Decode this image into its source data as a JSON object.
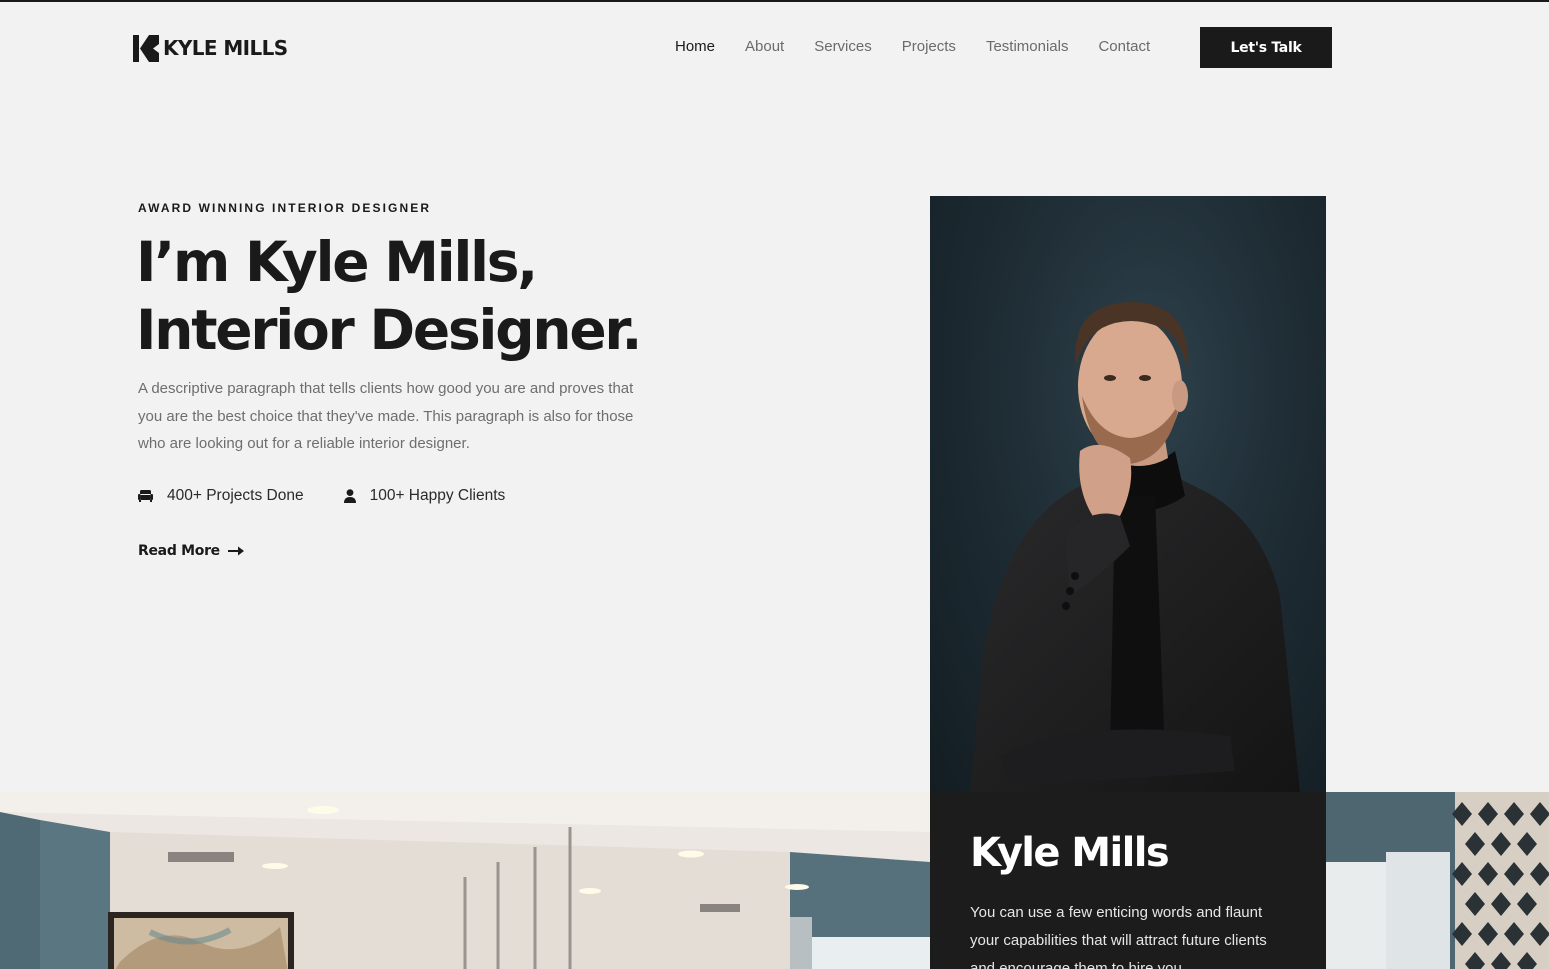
{
  "brand": {
    "logo_text": "KYLE MILLS"
  },
  "nav": {
    "items": [
      {
        "label": "Home",
        "active": true
      },
      {
        "label": "About",
        "active": false
      },
      {
        "label": "Services",
        "active": false
      },
      {
        "label": "Projects",
        "active": false
      },
      {
        "label": "Testimonials",
        "active": false
      },
      {
        "label": "Contact",
        "active": false
      }
    ],
    "cta_label": "Let's Talk"
  },
  "hero": {
    "eyebrow": "AWARD WINNING INTERIOR DESIGNER",
    "title_line1": "I’m Kyle Mills,",
    "title_line2": "Interior Designer.",
    "description": "A descriptive paragraph that tells clients how good you are and proves that you are the best choice that they've made. This paragraph is also for those who are looking out for a reliable interior designer.",
    "stats": [
      {
        "icon": "sofa-icon",
        "label": "400+ Projects Done"
      },
      {
        "icon": "user-icon",
        "label": "100+ Happy Clients"
      }
    ],
    "read_more_label": "Read More"
  },
  "profile_card": {
    "name": "Kyle Mills",
    "description": "You can use a few enticing words and flaunt your capabilities that will attract future clients and encourage them to hire you."
  },
  "colors": {
    "background": "#f2f2f2",
    "text_dark": "#1a1a1a",
    "text_muted": "#6e6e6e",
    "nav_muted": "#6b6b6b",
    "card_bg": "#1c1c1c",
    "cta_bg": "#1a1a1a"
  }
}
